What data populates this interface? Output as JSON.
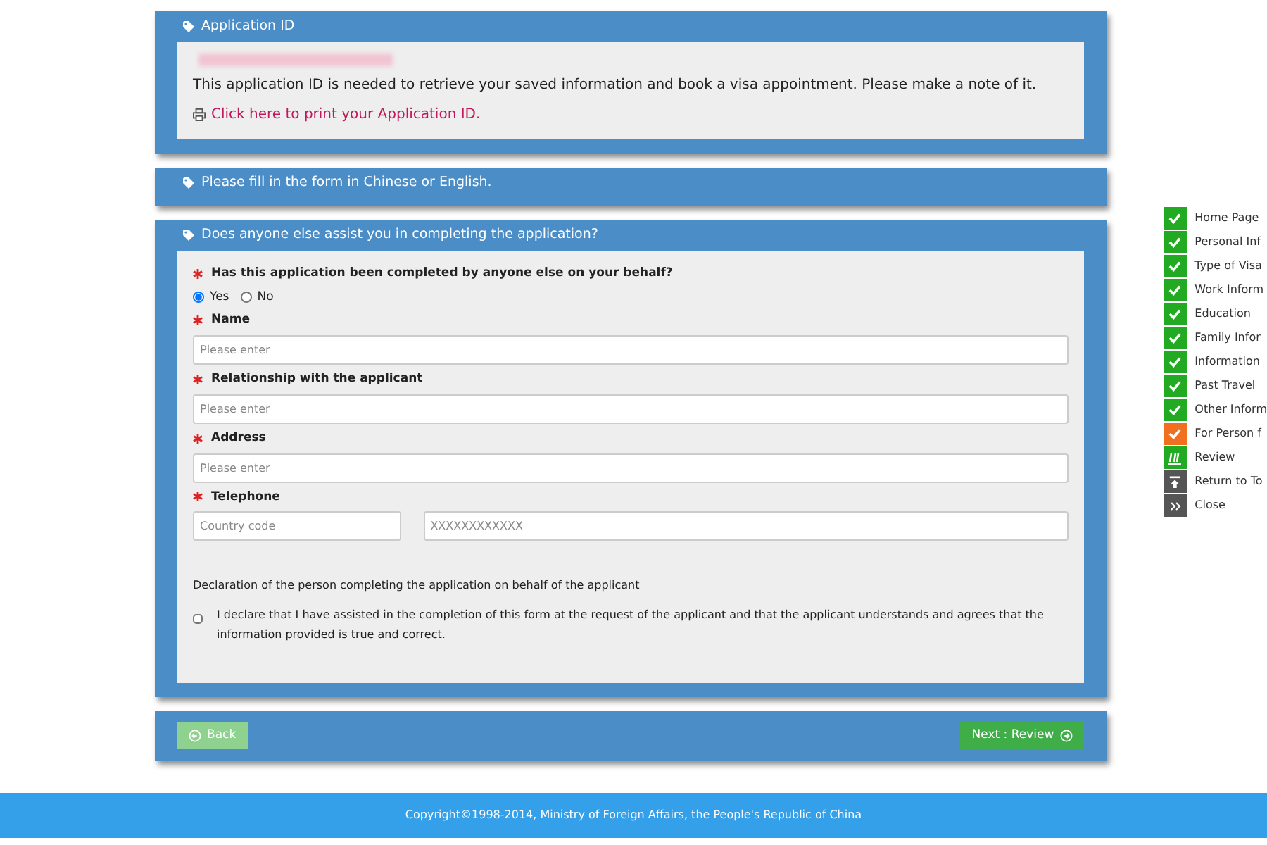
{
  "application_id_panel": {
    "title": "Application ID",
    "note": "This application ID is needed to retrieve your saved information and book a visa appointment. Please make a note of it.",
    "print_link": "Click here to print your Application ID."
  },
  "language_panel": {
    "title": "Please fill in the form in Chinese or English."
  },
  "assist_panel": {
    "title": "Does anyone else assist you in completing the application?",
    "question": {
      "label": "Has this application been completed by anyone else on your behalf?",
      "required": true,
      "options": [
        {
          "label": "Yes",
          "selected": true
        },
        {
          "label": "No",
          "selected": false
        }
      ]
    },
    "fields": [
      {
        "label": "Name",
        "required": true,
        "inputs": [
          {
            "placeholder": "Please enter"
          }
        ]
      },
      {
        "label": "Relationship with the applicant",
        "required": true,
        "inputs": [
          {
            "placeholder": "Please enter"
          }
        ]
      },
      {
        "label": "Address",
        "required": true,
        "inputs": [
          {
            "placeholder": "Please enter"
          }
        ]
      },
      {
        "label": "Telephone",
        "required": true,
        "inputs": [
          {
            "placeholder": "Country code"
          },
          {
            "placeholder": "XXXXXXXXXXXX"
          }
        ]
      }
    ],
    "declaration_title": "Declaration of the person completing the application on behalf of the applicant",
    "declaration": {
      "text": "I declare that I have assisted in the completion of this form at the request of the applicant and that the applicant understands and agrees that the information provided is true and correct.",
      "checked": false
    }
  },
  "buttons": {
    "back": "Back",
    "next": "Next : Review"
  },
  "footer": "Copyright©1998-2014, Ministry of Foreign Affairs, the People's Republic of China",
  "sidebar": {
    "items": [
      {
        "label": "Home Page",
        "kind": "done"
      },
      {
        "label": "Personal Inf",
        "kind": "done"
      },
      {
        "label": "Type of Visa",
        "kind": "done"
      },
      {
        "label": "Work Inform",
        "kind": "done"
      },
      {
        "label": "Education",
        "kind": "done"
      },
      {
        "label": "Family Infor",
        "kind": "done"
      },
      {
        "label": "Information",
        "kind": "done"
      },
      {
        "label": "Past Travel",
        "kind": "done"
      },
      {
        "label": "Other Inform",
        "kind": "done"
      },
      {
        "label": "For Person f",
        "kind": "current"
      },
      {
        "label": "Review",
        "kind": "review"
      },
      {
        "label": "Return to To",
        "kind": "top"
      },
      {
        "label": "Close",
        "kind": "close"
      }
    ]
  }
}
